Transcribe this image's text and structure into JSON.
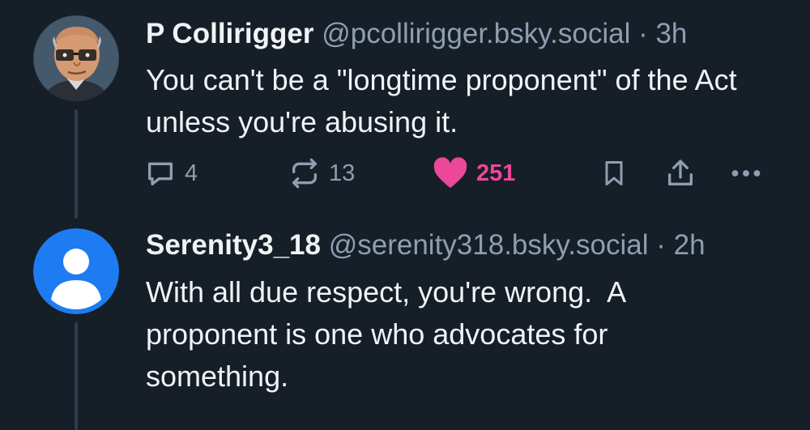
{
  "posts": [
    {
      "author": "P Collirigger",
      "handle": "@pcollirigger.bsky.social",
      "separator": "·",
      "time": "3h",
      "text": "You can't be a \"longtime proponent\" of the Act unless you're abusing it.",
      "avatar_icon": "illustrated-portrait-avatar",
      "actions": {
        "reply": {
          "icon": "reply-icon",
          "count": "4"
        },
        "repost": {
          "icon": "repost-icon",
          "count": "13"
        },
        "like": {
          "icon": "heart-icon",
          "count": "251",
          "liked": true,
          "color": "#ec4899"
        },
        "bookmark": {
          "icon": "bookmark-icon"
        },
        "share": {
          "icon": "share-icon"
        },
        "more": {
          "icon": "more-icon"
        }
      }
    },
    {
      "author": "Serenity3_18",
      "handle": "@serenity318.bsky.social",
      "separator": "·",
      "time": "2h",
      "text": "With all due respect, you're wrong.  A proponent is one who advocates for something.",
      "avatar_icon": "default-user-avatar",
      "avatar_color": "#1d7cf2"
    }
  ],
  "colors": {
    "background": "#161e27",
    "muted": "#8d9fb1",
    "thread_line": "#2e3d4d",
    "like": "#ec4899"
  }
}
